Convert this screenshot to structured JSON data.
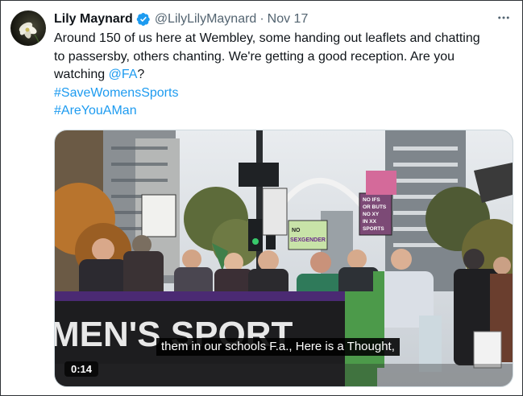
{
  "tweet": {
    "display_name": "Lily Maynard",
    "handle": "@LilyLilyMaynard",
    "separator": "·",
    "date": "Nov 17",
    "text_line1": "Around 150  of us here at Wembley, some handing out leaflets and chatting",
    "text_line2": "to passersby, others chanting. We're getting a good reception. Are you",
    "text_line3_prefix": "watching ",
    "mention": "@FA",
    "text_line3_suffix": "?",
    "hashtag1": "#SaveWomensSports",
    "hashtag2": "#AreYouAMan"
  },
  "video": {
    "caption": "them in our schools F.a., Here is a Thought,",
    "timestamp": "0:14",
    "banner_text": "MEN'S SPORT",
    "sign_right_lines": [
      "NO IFS",
      "OR BUTS",
      "NO XY",
      "IN XX",
      "SPORTS"
    ],
    "sign_green_lines": [
      "NO",
      "SEXGENDER"
    ]
  },
  "icons": {
    "verified": "verified-badge-icon",
    "more": "more-options-icon",
    "avatar": "flower-avatar"
  },
  "colors": {
    "link": "#1d9bf0",
    "verified": "#1d9bf0",
    "banner_purple": "#4b2a73",
    "banner_black": "#1d1d1f"
  }
}
